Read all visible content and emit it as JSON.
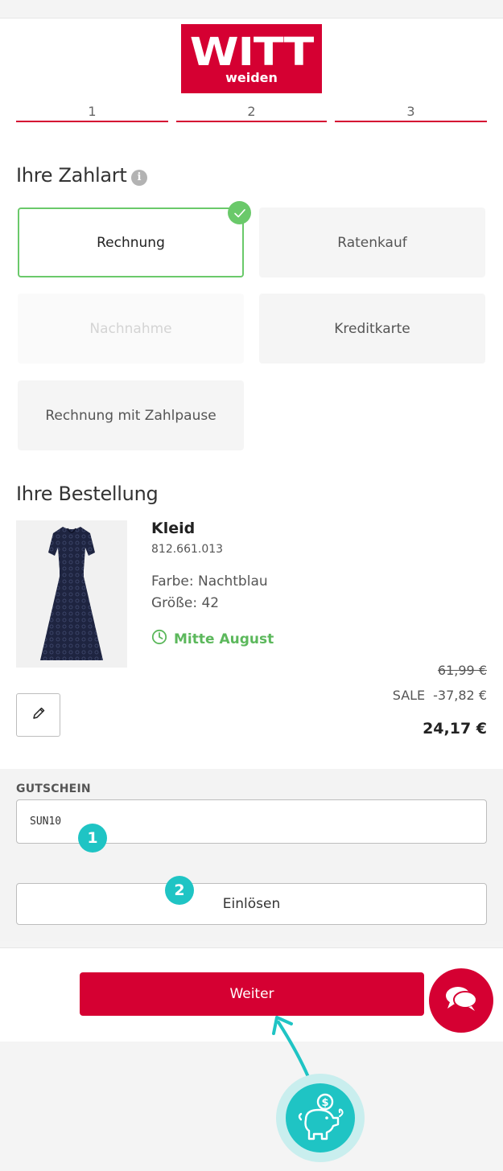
{
  "brand": {
    "name": "WITT",
    "sub": "weiden",
    "color": "#d50032"
  },
  "steps": [
    "1",
    "2",
    "3"
  ],
  "payment": {
    "title": "Ihre Zahlart",
    "info_icon": "i",
    "options": [
      {
        "label": "Rechnung",
        "state": "selected"
      },
      {
        "label": "Ratenkauf",
        "state": "available"
      },
      {
        "label": "Nachnahme",
        "state": "disabled"
      },
      {
        "label": "Kreditkarte",
        "state": "available"
      },
      {
        "label": "Rechnung mit Zahlpause",
        "state": "available"
      }
    ]
  },
  "order": {
    "title": "Ihre Bestellung",
    "product": {
      "name": "Kleid",
      "number": "812.661.013",
      "color": "Farbe: Nachtblau",
      "size": "Größe: 42",
      "delivery": "Mitte August"
    },
    "prices": {
      "old": "61,99 €",
      "sale_label": "SALE",
      "discount": "-37,82 €",
      "new": "24,17 €"
    }
  },
  "voucher": {
    "label": "GUTSCHEIN",
    "value": "SUN10",
    "redeem_label": "Einlösen",
    "badge1": "1",
    "badge2": "2"
  },
  "footer": {
    "next_label": "Weiter"
  },
  "colors": {
    "accent": "#d50032",
    "success": "#6ac96a",
    "teal": "#1fc4c4"
  },
  "icons": [
    "info-icon",
    "check-icon",
    "clock-icon",
    "pencil-icon",
    "chat-icon",
    "piggy-bank-icon",
    "arrow-icon"
  ]
}
